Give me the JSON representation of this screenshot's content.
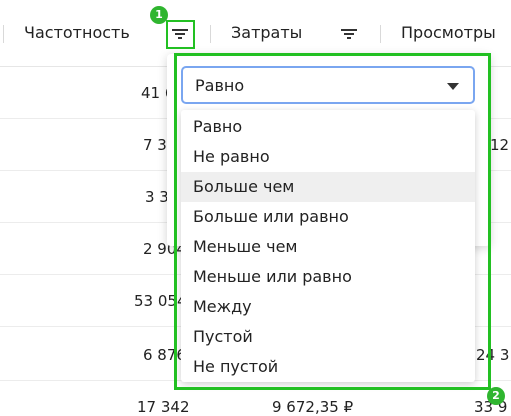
{
  "header": {
    "col1_label": "Частотность",
    "col2_label": "Затраты",
    "col3_label": "Просмотры"
  },
  "rows": [
    {
      "c1": "41 6"
    },
    {
      "c1": "7 3",
      "c3": "12"
    },
    {
      "c1": "3 3"
    },
    {
      "c1": "2 904"
    },
    {
      "c1": "53 054"
    },
    {
      "c1": "6 876",
      "c3": "24 3"
    },
    {
      "c1": "17 342",
      "c2": "9 672,35 ₽",
      "c3": "33 9"
    }
  ],
  "filter": {
    "selected_value": "Равно",
    "options": [
      "Равно",
      "Не равно",
      "Больше чем",
      "Больше или равно",
      "Меньше чем",
      "Меньше или равно",
      "Между",
      "Пустой",
      "Не пустой"
    ],
    "hovered_option": "Больше чем"
  },
  "annotations": {
    "badge1": "1",
    "badge2": "2",
    "highlight_color": "#22c022"
  }
}
